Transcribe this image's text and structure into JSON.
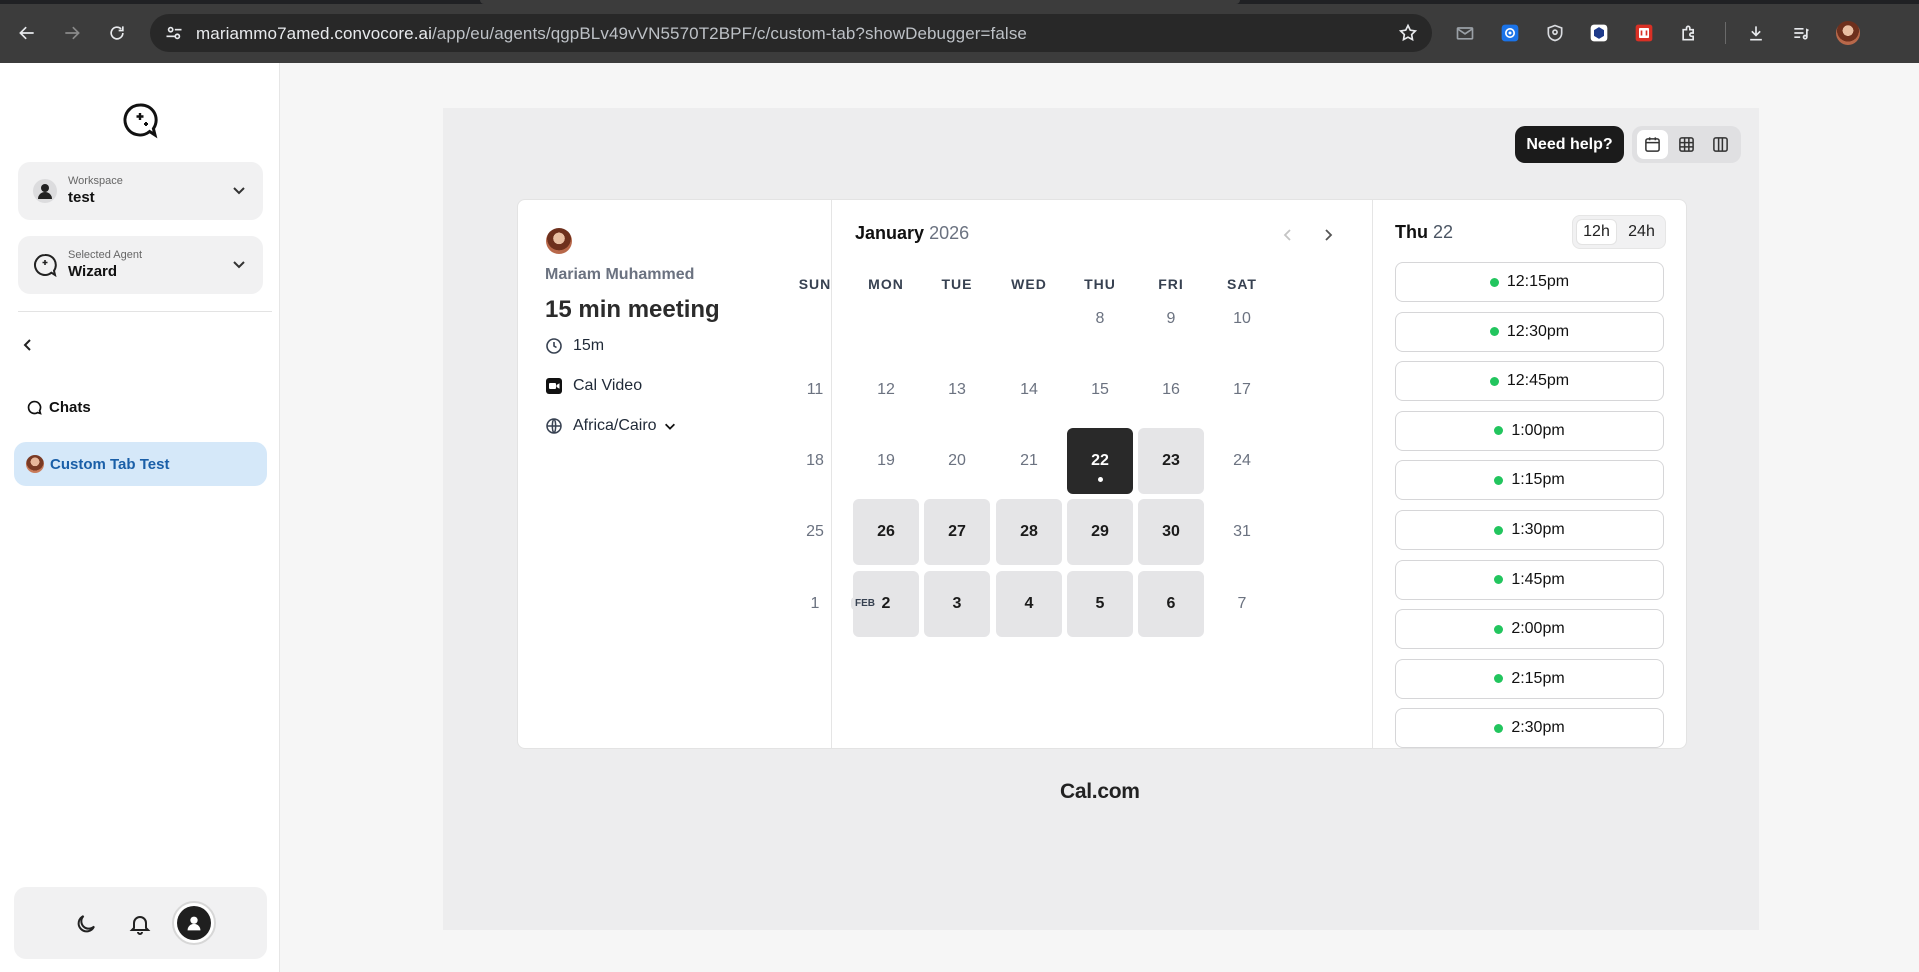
{
  "browser": {
    "url_host": "mariammo7amed.convocore.ai",
    "url_path": "/app/eu/agents/qgpBLv49vVN5570T2BPF/c/custom-tab?showDebugger=false"
  },
  "sidebar": {
    "workspace": {
      "label": "Workspace",
      "value": "test"
    },
    "agent": {
      "label": "Selected Agent",
      "value": "Wizard"
    },
    "chats_label": "Chats",
    "active_item_label": "Custom Tab Test"
  },
  "embed": {
    "help_label": "Need help?",
    "host_name": "Mariam Muhammed",
    "event_title": "15 min meeting",
    "duration": "15m",
    "location": "Cal Video",
    "timezone": "Africa/Cairo",
    "month": "January",
    "year": "2026",
    "weekdays": [
      "SUN",
      "MON",
      "TUE",
      "WED",
      "THU",
      "FRI",
      "SAT"
    ],
    "next_month_badge": "FEB",
    "weeks": [
      [
        {
          "d": ""
        },
        {
          "d": ""
        },
        {
          "d": ""
        },
        {
          "d": ""
        },
        {
          "d": "8",
          "s": "dis"
        },
        {
          "d": "9",
          "s": "dis"
        },
        {
          "d": "10",
          "s": "dis"
        }
      ],
      [
        {
          "d": "11",
          "s": "dis"
        },
        {
          "d": "12",
          "s": "dis"
        },
        {
          "d": "13",
          "s": "dis"
        },
        {
          "d": "14",
          "s": "dis"
        },
        {
          "d": "15",
          "s": "dis"
        },
        {
          "d": "16",
          "s": "dis"
        },
        {
          "d": "17",
          "s": "dis"
        }
      ],
      [
        {
          "d": "18",
          "s": "dis"
        },
        {
          "d": "19",
          "s": "dis"
        },
        {
          "d": "20",
          "s": "dis"
        },
        {
          "d": "21",
          "s": "dis"
        },
        {
          "d": "22",
          "s": "sel"
        },
        {
          "d": "23",
          "s": "avail"
        },
        {
          "d": "24",
          "s": "dis"
        }
      ],
      [
        {
          "d": "25",
          "s": "dis"
        },
        {
          "d": "26",
          "s": "avail"
        },
        {
          "d": "27",
          "s": "avail"
        },
        {
          "d": "28",
          "s": "avail"
        },
        {
          "d": "29",
          "s": "avail"
        },
        {
          "d": "30",
          "s": "avail"
        },
        {
          "d": "31",
          "s": "dis"
        }
      ],
      [
        {
          "d": "1",
          "s": "dis"
        },
        {
          "d": "2",
          "s": "avail"
        },
        {
          "d": "3",
          "s": "avail"
        },
        {
          "d": "4",
          "s": "avail"
        },
        {
          "d": "5",
          "s": "avail"
        },
        {
          "d": "6",
          "s": "avail"
        },
        {
          "d": "7",
          "s": "dis"
        }
      ]
    ],
    "selected_weekday": "Thu",
    "selected_day": "22",
    "format_12h": "12h",
    "format_24h": "24h",
    "slots": [
      "12:15pm",
      "12:30pm",
      "12:45pm",
      "1:00pm",
      "1:15pm",
      "1:30pm",
      "1:45pm",
      "2:00pm",
      "2:15pm",
      "2:30pm"
    ],
    "footer_brand": "Cal.com"
  }
}
